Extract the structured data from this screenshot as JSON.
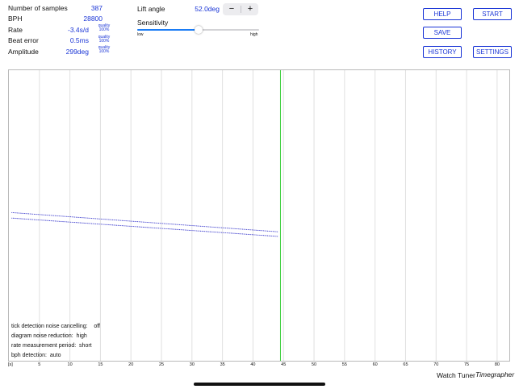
{
  "stats": [
    {
      "label": "Number of samples",
      "value": "387"
    },
    {
      "label": "BPH",
      "value": "28800"
    },
    {
      "label": "Rate",
      "value": "-3.4s/d",
      "quality_label": "quality",
      "quality": "100%"
    },
    {
      "label": "Beat error",
      "value": "0.5ms",
      "quality_label": "quality",
      "quality": "100%"
    },
    {
      "label": "Amplitude",
      "value": "299deg",
      "quality_label": "quality",
      "quality": "100%"
    }
  ],
  "lift_angle": {
    "label": "Lift angle",
    "value": "52.0deg",
    "minus": "−",
    "plus": "+"
  },
  "sensitivity": {
    "label": "Sensitivity",
    "low": "low",
    "high": "high",
    "level": 0.5
  },
  "buttons": {
    "help": "HELP",
    "start": "START",
    "save": "SAVE",
    "history": "HISTORY",
    "settings": "SETTINGS"
  },
  "chart_data": {
    "type": "scatter",
    "x_unit_label": "[s]",
    "xticks": [
      "5",
      "10",
      "15",
      "20",
      "25",
      "30",
      "35",
      "40",
      "45",
      "50",
      "55",
      "60",
      "65",
      "70",
      "75",
      "80"
    ],
    "xlim": [
      0,
      82
    ],
    "current_time": 44.5,
    "series": [
      {
        "x": [
          0.5,
          44
        ],
        "y": [
          0.49,
          0.556
        ]
      },
      {
        "x": [
          0.5,
          44
        ],
        "y": [
          0.509,
          0.572
        ]
      }
    ],
    "colors": {
      "dots": "#2b2bc8",
      "marker": "#3ccf3c",
      "grid": "#e0e0e0"
    }
  },
  "settings_info": [
    {
      "label": "tick detection noise cancelling:",
      "value": "off"
    },
    {
      "label": "diagram noise reduction:",
      "value": "high"
    },
    {
      "label": "rate measurement period:",
      "value": "short"
    },
    {
      "label": "bph detection:",
      "value": "auto"
    }
  ],
  "brand": {
    "name": "Watch Tuner",
    "product": "Timegrapher"
  }
}
